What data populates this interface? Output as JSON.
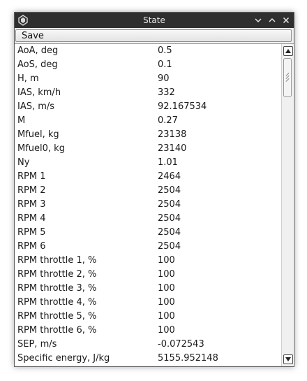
{
  "window": {
    "title": "State",
    "icons": {
      "app": "app-icon",
      "minimize": "chevron-down-icon",
      "maximize": "chevron-up-icon",
      "close": "close-icon"
    },
    "colors": {
      "titlebar": "#2f2f2f",
      "text": "#1a1a1a"
    }
  },
  "toolbar": {
    "save_label": "Save"
  },
  "rows": [
    {
      "key": "AoA, deg",
      "value": "0.5"
    },
    {
      "key": "AoS, deg",
      "value": "0.1"
    },
    {
      "key": "H, m",
      "value": "90"
    },
    {
      "key": "IAS, km/h",
      "value": "332"
    },
    {
      "key": "IAS, m/s",
      "value": "92.167534"
    },
    {
      "key": "M",
      "value": "0.27"
    },
    {
      "key": "Mfuel, kg",
      "value": "23138"
    },
    {
      "key": "Mfuel0, kg",
      "value": "23140"
    },
    {
      "key": "Ny",
      "value": "1.01"
    },
    {
      "key": "RPM 1",
      "value": "2464"
    },
    {
      "key": "RPM 2",
      "value": "2504"
    },
    {
      "key": "RPM 3",
      "value": "2504"
    },
    {
      "key": "RPM 4",
      "value": "2504"
    },
    {
      "key": "RPM 5",
      "value": "2504"
    },
    {
      "key": "RPM 6",
      "value": "2504"
    },
    {
      "key": "RPM throttle 1, %",
      "value": "100"
    },
    {
      "key": "RPM throttle 2, %",
      "value": "100"
    },
    {
      "key": "RPM throttle 3, %",
      "value": "100"
    },
    {
      "key": "RPM throttle 4, %",
      "value": "100"
    },
    {
      "key": "RPM throttle 5, %",
      "value": "100"
    },
    {
      "key": "RPM throttle 6, %",
      "value": "100"
    },
    {
      "key": "SEP, m/s",
      "value": "-0.072543"
    },
    {
      "key": "Specific energy, J/kg",
      "value": "5155.952148"
    }
  ],
  "scrollbar": {
    "position": 0.0
  }
}
